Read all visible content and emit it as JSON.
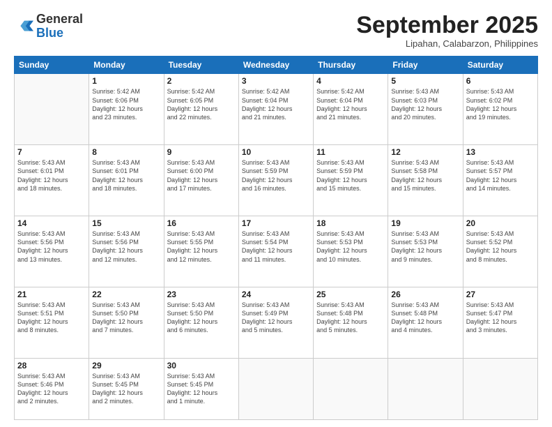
{
  "header": {
    "logo": {
      "general": "General",
      "blue": "Blue"
    },
    "title": "September 2025",
    "subtitle": "Lipahan, Calabarzon, Philippines"
  },
  "weekdays": [
    "Sunday",
    "Monday",
    "Tuesday",
    "Wednesday",
    "Thursday",
    "Friday",
    "Saturday"
  ],
  "weeks": [
    [
      null,
      {
        "day": "1",
        "sunrise": "5:42 AM",
        "sunset": "6:06 PM",
        "daylight": "12 hours and 23 minutes."
      },
      {
        "day": "2",
        "sunrise": "5:42 AM",
        "sunset": "6:05 PM",
        "daylight": "12 hours and 22 minutes."
      },
      {
        "day": "3",
        "sunrise": "5:42 AM",
        "sunset": "6:04 PM",
        "daylight": "12 hours and 21 minutes."
      },
      {
        "day": "4",
        "sunrise": "5:42 AM",
        "sunset": "6:04 PM",
        "daylight": "12 hours and 21 minutes."
      },
      {
        "day": "5",
        "sunrise": "5:43 AM",
        "sunset": "6:03 PM",
        "daylight": "12 hours and 20 minutes."
      },
      {
        "day": "6",
        "sunrise": "5:43 AM",
        "sunset": "6:02 PM",
        "daylight": "12 hours and 19 minutes."
      }
    ],
    [
      {
        "day": "7",
        "sunrise": "5:43 AM",
        "sunset": "6:01 PM",
        "daylight": "12 hours and 18 minutes."
      },
      {
        "day": "8",
        "sunrise": "5:43 AM",
        "sunset": "6:01 PM",
        "daylight": "12 hours and 18 minutes."
      },
      {
        "day": "9",
        "sunrise": "5:43 AM",
        "sunset": "6:00 PM",
        "daylight": "12 hours and 17 minutes."
      },
      {
        "day": "10",
        "sunrise": "5:43 AM",
        "sunset": "5:59 PM",
        "daylight": "12 hours and 16 minutes."
      },
      {
        "day": "11",
        "sunrise": "5:43 AM",
        "sunset": "5:59 PM",
        "daylight": "12 hours and 15 minutes."
      },
      {
        "day": "12",
        "sunrise": "5:43 AM",
        "sunset": "5:58 PM",
        "daylight": "12 hours and 15 minutes."
      },
      {
        "day": "13",
        "sunrise": "5:43 AM",
        "sunset": "5:57 PM",
        "daylight": "12 hours and 14 minutes."
      }
    ],
    [
      {
        "day": "14",
        "sunrise": "5:43 AM",
        "sunset": "5:56 PM",
        "daylight": "12 hours and 13 minutes."
      },
      {
        "day": "15",
        "sunrise": "5:43 AM",
        "sunset": "5:56 PM",
        "daylight": "12 hours and 12 minutes."
      },
      {
        "day": "16",
        "sunrise": "5:43 AM",
        "sunset": "5:55 PM",
        "daylight": "12 hours and 12 minutes."
      },
      {
        "day": "17",
        "sunrise": "5:43 AM",
        "sunset": "5:54 PM",
        "daylight": "12 hours and 11 minutes."
      },
      {
        "day": "18",
        "sunrise": "5:43 AM",
        "sunset": "5:53 PM",
        "daylight": "12 hours and 10 minutes."
      },
      {
        "day": "19",
        "sunrise": "5:43 AM",
        "sunset": "5:53 PM",
        "daylight": "12 hours and 9 minutes."
      },
      {
        "day": "20",
        "sunrise": "5:43 AM",
        "sunset": "5:52 PM",
        "daylight": "12 hours and 8 minutes."
      }
    ],
    [
      {
        "day": "21",
        "sunrise": "5:43 AM",
        "sunset": "5:51 PM",
        "daylight": "12 hours and 8 minutes."
      },
      {
        "day": "22",
        "sunrise": "5:43 AM",
        "sunset": "5:50 PM",
        "daylight": "12 hours and 7 minutes."
      },
      {
        "day": "23",
        "sunrise": "5:43 AM",
        "sunset": "5:50 PM",
        "daylight": "12 hours and 6 minutes."
      },
      {
        "day": "24",
        "sunrise": "5:43 AM",
        "sunset": "5:49 PM",
        "daylight": "12 hours and 5 minutes."
      },
      {
        "day": "25",
        "sunrise": "5:43 AM",
        "sunset": "5:48 PM",
        "daylight": "12 hours and 5 minutes."
      },
      {
        "day": "26",
        "sunrise": "5:43 AM",
        "sunset": "5:48 PM",
        "daylight": "12 hours and 4 minutes."
      },
      {
        "day": "27",
        "sunrise": "5:43 AM",
        "sunset": "5:47 PM",
        "daylight": "12 hours and 3 minutes."
      }
    ],
    [
      {
        "day": "28",
        "sunrise": "5:43 AM",
        "sunset": "5:46 PM",
        "daylight": "12 hours and 2 minutes."
      },
      {
        "day": "29",
        "sunrise": "5:43 AM",
        "sunset": "5:45 PM",
        "daylight": "12 hours and 2 minutes."
      },
      {
        "day": "30",
        "sunrise": "5:43 AM",
        "sunset": "5:45 PM",
        "daylight": "12 hours and 1 minute."
      },
      null,
      null,
      null,
      null
    ]
  ],
  "labels": {
    "sunrise": "Sunrise:",
    "sunset": "Sunset:",
    "daylight": "Daylight:"
  }
}
